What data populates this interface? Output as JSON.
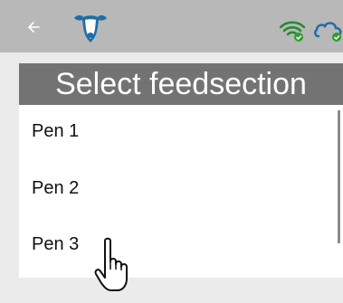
{
  "appbar": {
    "icons": {
      "back": "arrow-left-icon",
      "logo": "cow-head-logo-icon",
      "wifi": "wifi-connected-icon",
      "cloud": "cloud-synced-icon"
    },
    "colors": {
      "bar": "#b8b8b8",
      "status_ok": "#2e9d2e"
    }
  },
  "dialog": {
    "title": "Select feedsection",
    "items": [
      {
        "label": "Pen 1"
      },
      {
        "label": "Pen 2"
      },
      {
        "label": "Pen 3"
      }
    ],
    "colors": {
      "header": "#737373"
    }
  },
  "cursor": {
    "icon": "hand-pointer-icon"
  }
}
